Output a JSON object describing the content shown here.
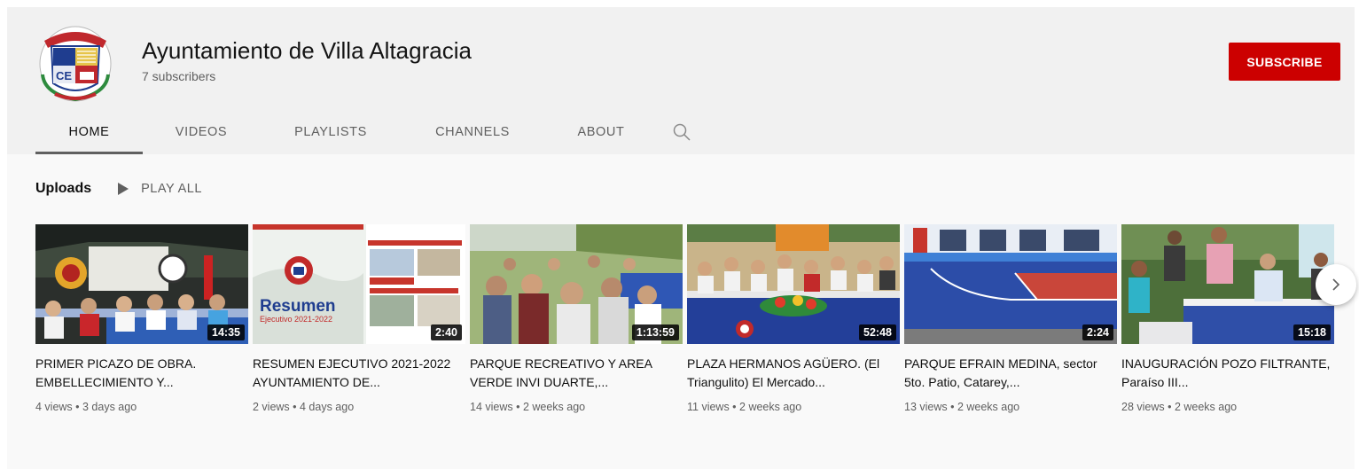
{
  "channel": {
    "name": "Ayuntamiento de Villa Altagracia",
    "subscribers": "7 subscribers",
    "subscribe_label": "SUBSCRIBE"
  },
  "tabs": [
    {
      "label": "HOME",
      "active": true
    },
    {
      "label": "VIDEOS",
      "active": false
    },
    {
      "label": "PLAYLISTS",
      "active": false
    },
    {
      "label": "CHANNELS",
      "active": false
    },
    {
      "label": "ABOUT",
      "active": false
    }
  ],
  "section": {
    "title": "Uploads",
    "play_all": "PLAY ALL"
  },
  "videos": [
    {
      "title": "PRIMER PICAZO DE OBRA. EMBELLECIMIENTO Y...",
      "duration": "14:35",
      "views": "4 views",
      "age": "3 days ago",
      "meta": "4 views • 3 days ago"
    },
    {
      "title": "RESUMEN EJECUTIVO 2021-2022 AYUNTAMIENTO DE...",
      "duration": "2:40",
      "views": "2 views",
      "age": "4 days ago",
      "meta": "2 views • 4 days ago",
      "thumb_text": {
        "big": "Resumen",
        "small": "Ejecutivo 2021-2022"
      }
    },
    {
      "title": "PARQUE RECREATIVO Y AREA VERDE INVI DUARTE,...",
      "duration": "1:13:59",
      "views": "14 views",
      "age": "2 weeks ago",
      "meta": "14 views • 2 weeks ago"
    },
    {
      "title": "PLAZA HERMANOS AGÜERO. (El Triangulito) El Mercado...",
      "duration": "52:48",
      "views": "11 views",
      "age": "2 weeks ago",
      "meta": "11 views • 2 weeks ago"
    },
    {
      "title": "PARQUE EFRAIN MEDINA, sector 5to. Patio, Catarey,...",
      "duration": "2:24",
      "views": "13 views",
      "age": "2 weeks ago",
      "meta": "13 views • 2 weeks ago"
    },
    {
      "title": "INAUGURACIÓN POZO FILTRANTE, Paraíso III...",
      "duration": "15:18",
      "views": "28 views",
      "age": "2 weeks ago",
      "meta": "28 views • 2 weeks ago"
    }
  ],
  "icons": {
    "search": "search-icon",
    "play": "play-icon",
    "next": "chevron-right-icon"
  },
  "colors": {
    "subscribe": "#cc0000",
    "header_bg": "#f1f1f1",
    "page_bg": "#f9f9f9"
  }
}
